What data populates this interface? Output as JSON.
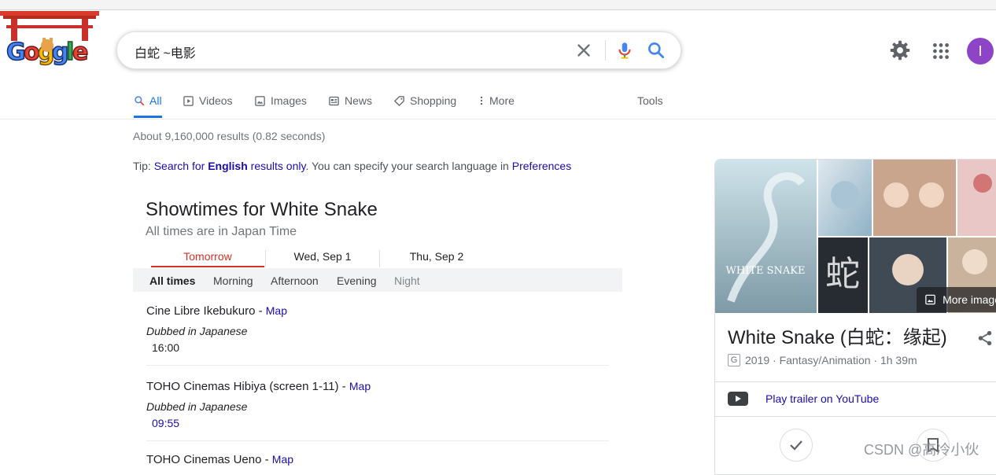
{
  "search": {
    "query": "白蛇  ~电影"
  },
  "header": {
    "avatar_letter": "I"
  },
  "tabs": [
    {
      "label": "All",
      "icon": "search-icon"
    },
    {
      "label": "Videos",
      "icon": "play-icon"
    },
    {
      "label": "Images",
      "icon": "image-icon"
    },
    {
      "label": "News",
      "icon": "news-icon"
    },
    {
      "label": "Shopping",
      "icon": "tag-icon"
    },
    {
      "label": "More",
      "icon": "more-vert-icon"
    },
    {
      "label": "Tools"
    }
  ],
  "results": {
    "stats": "About 9,160,000 results (0.82 seconds)",
    "tip": {
      "prefix": "Tip: ",
      "link1": "Search for ",
      "link_bold": "English",
      "link2": " results only",
      "middle": ". You can specify your search language in ",
      "link3": "Preferences"
    }
  },
  "showtimes": {
    "title": "Showtimes for White Snake",
    "subtitle": "All times are in Japan Time",
    "days": [
      "Tomorrow",
      "Wed, Sep 1",
      "Thu, Sep 2"
    ],
    "filters": [
      "All times",
      "Morning",
      "Afternoon",
      "Evening",
      "Night"
    ],
    "sep": " - ",
    "cinemas": [
      {
        "name": "Cine Libre Ikebukuro",
        "map": "Map",
        "note": "Dubbed in Japanese",
        "time": "16:00",
        "time_color": "#202124"
      },
      {
        "name": "TOHO Cinemas Hibiya (screen 1-11)",
        "map": "Map",
        "note": "Dubbed in Japanese",
        "time": "09:55",
        "time_color": "#1a0dab"
      },
      {
        "name": "TOHO Cinemas Ueno",
        "map": "Map"
      }
    ]
  },
  "knowledge_panel": {
    "title": "White Snake (白蛇：缘起)",
    "badge": "G",
    "meta": "2019 · Fantasy/Animation · 1h 39m",
    "trailer": "Play trailer on YouTube",
    "more_images": "More images",
    "poster_text": "WHITE SNAKE"
  },
  "watermark": "CSDN @高冷小伙"
}
